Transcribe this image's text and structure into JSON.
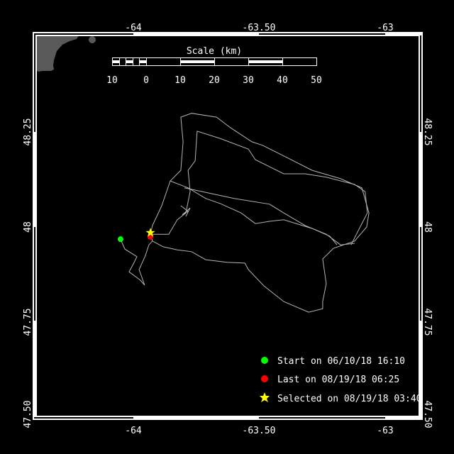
{
  "map": {
    "lon_ticks": [
      {
        "value": -64,
        "label": "-64"
      },
      {
        "value": -63.5,
        "label": "-63.50"
      },
      {
        "value": -63,
        "label": "-63"
      }
    ],
    "lat_ticks": [
      {
        "value": 48.25,
        "label": "48.25"
      },
      {
        "value": 48,
        "label": "48"
      },
      {
        "value": 47.75,
        "label": "47.75"
      },
      {
        "value": 47.5,
        "label": "47.50"
      }
    ],
    "land_color": "#595959",
    "track_color": "#b4b4b4"
  },
  "scale": {
    "title": "Scale (km)",
    "labels": [
      "10",
      "0",
      "10",
      "20",
      "30",
      "40",
      "50"
    ]
  },
  "legend": {
    "start": {
      "label": "Start on 06/10/18 16:10",
      "color": "#00ff00",
      "lon": -64.051,
      "lat": 47.968
    },
    "last": {
      "label": "Last on 08/19/18 06:25",
      "color": "#ff0000",
      "lon": -63.932,
      "lat": 47.974
    },
    "selected": {
      "label": "Selected on 08/19/18 03:40",
      "color": "#ffff00",
      "lon": -63.932,
      "lat": 47.985
    }
  },
  "track": [
    [
      [
        -64.051,
        47.968
      ],
      [
        -64.034,
        47.942
      ],
      [
        -63.986,
        47.922
      ],
      [
        -64.0,
        47.903
      ],
      [
        -64.017,
        47.882
      ],
      [
        -63.972,
        47.86
      ],
      [
        -63.955,
        47.847
      ],
      [
        -63.977,
        47.888
      ],
      [
        -63.952,
        47.925
      ],
      [
        -63.938,
        47.953
      ],
      [
        -63.924,
        47.963
      ],
      [
        -63.932,
        47.981
      ]
    ],
    [
      [
        -63.924,
        47.963
      ],
      [
        -63.881,
        47.948
      ],
      [
        -63.825,
        47.94
      ],
      [
        -63.768,
        47.935
      ],
      [
        -63.712,
        47.914
      ],
      [
        -63.627,
        47.907
      ],
      [
        -63.556,
        47.905
      ],
      [
        -63.542,
        47.888
      ],
      [
        -63.48,
        47.845
      ],
      [
        -63.401,
        47.804
      ],
      [
        -63.302,
        47.776
      ],
      [
        -63.246,
        47.785
      ],
      [
        -63.246,
        47.804
      ],
      [
        -63.232,
        47.851
      ],
      [
        -63.246,
        47.916
      ],
      [
        -63.203,
        47.944
      ],
      [
        -63.119,
        47.963
      ],
      [
        -63.071,
        48.0
      ],
      [
        -63.062,
        48.037
      ],
      [
        -63.09,
        48.103
      ],
      [
        -63.175,
        48.127
      ],
      [
        -63.288,
        48.149
      ],
      [
        -63.401,
        48.187
      ],
      [
        -63.486,
        48.215
      ],
      [
        -63.528,
        48.224
      ],
      [
        -63.613,
        48.261
      ],
      [
        -63.669,
        48.289
      ],
      [
        -63.768,
        48.299
      ],
      [
        -63.811,
        48.289
      ],
      [
        -63.802,
        48.224
      ],
      [
        -63.811,
        48.149
      ],
      [
        -63.853,
        48.121
      ],
      [
        -63.887,
        48.056
      ],
      [
        -63.924,
        48.004
      ],
      [
        -63.932,
        47.981
      ]
    ],
    [
      [
        -63.924,
        47.981
      ],
      [
        -63.859,
        47.981
      ],
      [
        -63.825,
        48.019
      ],
      [
        -63.791,
        48.037
      ],
      [
        -63.774,
        48.093
      ],
      [
        -63.782,
        48.149
      ],
      [
        -63.754,
        48.174
      ],
      [
        -63.746,
        48.252
      ],
      [
        -63.655,
        48.233
      ],
      [
        -63.542,
        48.205
      ],
      [
        -63.514,
        48.177
      ],
      [
        -63.401,
        48.14
      ],
      [
        -63.316,
        48.14
      ],
      [
        -63.232,
        48.131
      ],
      [
        -63.119,
        48.112
      ],
      [
        -63.077,
        48.093
      ],
      [
        -63.068,
        48.037
      ],
      [
        -63.104,
        47.991
      ],
      [
        -63.133,
        47.953
      ]
    ],
    [
      [
        -63.853,
        48.121
      ],
      [
        -63.782,
        48.103
      ],
      [
        -63.712,
        48.075
      ],
      [
        -63.655,
        48.062
      ],
      [
        -63.571,
        48.037
      ],
      [
        -63.514,
        48.009
      ],
      [
        -63.458,
        48.015
      ],
      [
        -63.401,
        48.019
      ],
      [
        -63.288,
        47.996
      ],
      [
        -63.218,
        47.976
      ],
      [
        -63.189,
        47.953
      ]
    ],
    [
      [
        -63.797,
        48.103
      ],
      [
        -63.599,
        48.075
      ],
      [
        -63.458,
        48.06
      ],
      [
        -63.401,
        48.037
      ],
      [
        -63.316,
        48.004
      ],
      [
        -63.232,
        47.981
      ],
      [
        -63.175,
        47.953
      ],
      [
        -63.119,
        47.957
      ]
    ],
    [
      [
        -63.811,
        48.056
      ],
      [
        -63.782,
        48.041
      ],
      [
        -63.805,
        48.032
      ],
      [
        -63.774,
        48.05
      ],
      [
        -63.791,
        48.028
      ]
    ]
  ]
}
